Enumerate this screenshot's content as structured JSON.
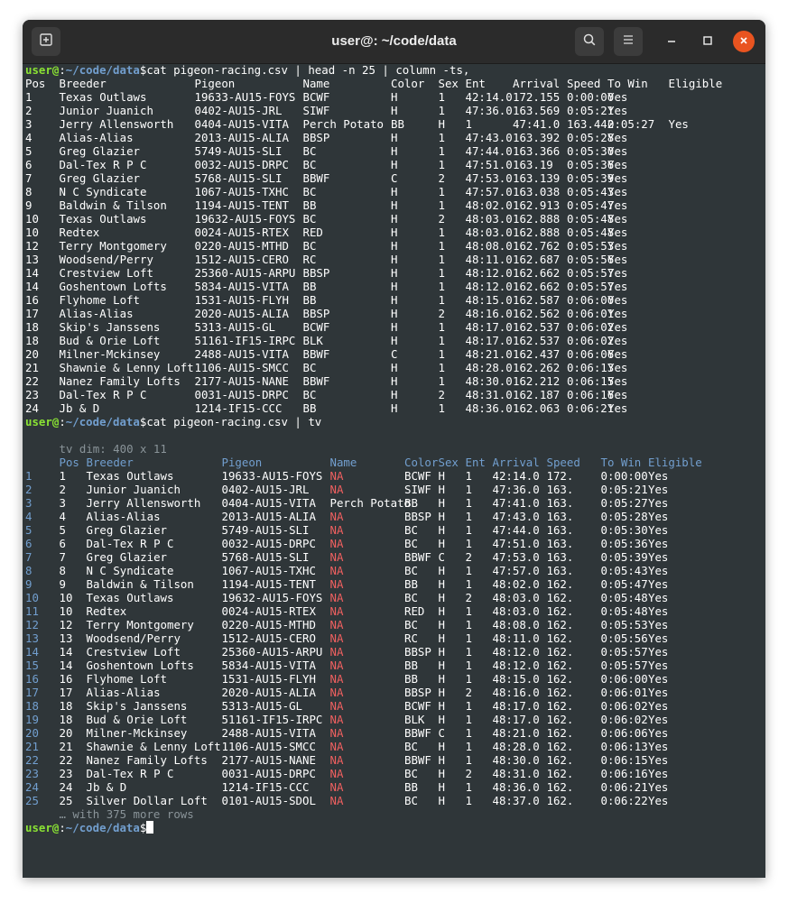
{
  "window": {
    "title": "user@: ~/code/data"
  },
  "titlebar_icons": {
    "new_tab": "new-tab-icon",
    "search": "search-icon",
    "menu": "hamburger-menu-icon",
    "minimize": "minimize-icon",
    "maximize": "maximize-icon",
    "close": "close-icon"
  },
  "prompt": {
    "user": "user@",
    "sep": ":",
    "path": "~/code/data",
    "dollar": "$"
  },
  "commands": [
    "cat pigeon-racing.csv | head -n 25 | column -ts,",
    "cat pigeon-racing.csv | tv"
  ],
  "csv_header": [
    "Pos",
    "Breeder",
    "Pigeon",
    "Name",
    "Color",
    "Sex",
    "Ent",
    "Arrival",
    "Speed",
    "To Win",
    "Eligible"
  ],
  "csv_rows": [
    [
      "1",
      "Texas Outlaws",
      "19633-AU15-FOYS",
      "BCWF",
      "H",
      "1",
      "42:14.0",
      "172.155",
      "0:00:00",
      "Yes"
    ],
    [
      "2",
      "Junior Juanich",
      "0402-AU15-JRL",
      "SIWF",
      "H",
      "1",
      "47:36.0",
      "163.569",
      "0:05:21",
      "Yes"
    ],
    [
      "3",
      "Jerry Allensworth",
      "0404-AU15-VITA",
      "Perch Potato",
      "BB",
      "H",
      "1",
      "47:41.0",
      "163.442",
      "0:05:27",
      "Yes"
    ],
    [
      "4",
      "Alias-Alias",
      "2013-AU15-ALIA",
      "BBSP",
      "H",
      "1",
      "47:43.0",
      "163.392",
      "0:05:28",
      "Yes"
    ],
    [
      "5",
      "Greg Glazier",
      "5749-AU15-SLI",
      "BC",
      "H",
      "1",
      "47:44.0",
      "163.366",
      "0:05:30",
      "Yes"
    ],
    [
      "6",
      "Dal-Tex R P C",
      "0032-AU15-DRPC",
      "BC",
      "H",
      "1",
      "47:51.0",
      "163.19",
      "0:05:36",
      "Yes"
    ],
    [
      "7",
      "Greg Glazier",
      "5768-AU15-SLI",
      "BBWF",
      "C",
      "2",
      "47:53.0",
      "163.139",
      "0:05:39",
      "Yes"
    ],
    [
      "8",
      "N C Syndicate",
      "1067-AU15-TXHC",
      "BC",
      "H",
      "1",
      "47:57.0",
      "163.038",
      "0:05:43",
      "Yes"
    ],
    [
      "9",
      "Baldwin & Tilson",
      "1194-AU15-TENT",
      "BB",
      "H",
      "1",
      "48:02.0",
      "162.913",
      "0:05:47",
      "Yes"
    ],
    [
      "10",
      "Texas Outlaws",
      "19632-AU15-FOYS",
      "BC",
      "H",
      "2",
      "48:03.0",
      "162.888",
      "0:05:48",
      "Yes"
    ],
    [
      "10",
      "Redtex",
      "0024-AU15-RTEX",
      "RED",
      "H",
      "1",
      "48:03.0",
      "162.888",
      "0:05:48",
      "Yes"
    ],
    [
      "12",
      "Terry Montgomery",
      "0220-AU15-MTHD",
      "BC",
      "H",
      "1",
      "48:08.0",
      "162.762",
      "0:05:53",
      "Yes"
    ],
    [
      "13",
      "Woodsend/Perry",
      "1512-AU15-CERO",
      "RC",
      "H",
      "1",
      "48:11.0",
      "162.687",
      "0:05:56",
      "Yes"
    ],
    [
      "14",
      "Crestview Loft",
      "25360-AU15-ARPU",
      "BBSP",
      "H",
      "1",
      "48:12.0",
      "162.662",
      "0:05:57",
      "Yes"
    ],
    [
      "14",
      "Goshentown Lofts",
      "5834-AU15-VITA",
      "BB",
      "H",
      "1",
      "48:12.0",
      "162.662",
      "0:05:57",
      "Yes"
    ],
    [
      "16",
      "Flyhome Loft",
      "1531-AU15-FLYH",
      "BB",
      "H",
      "1",
      "48:15.0",
      "162.587",
      "0:06:00",
      "Yes"
    ],
    [
      "17",
      "Alias-Alias",
      "2020-AU15-ALIA",
      "BBSP",
      "H",
      "2",
      "48:16.0",
      "162.562",
      "0:06:01",
      "Yes"
    ],
    [
      "18",
      "Skip's Janssens",
      "5313-AU15-GL",
      "BCWF",
      "H",
      "1",
      "48:17.0",
      "162.537",
      "0:06:02",
      "Yes"
    ],
    [
      "18",
      "Bud & Orie Loft",
      "51161-IF15-IRPC",
      "BLK",
      "H",
      "1",
      "48:17.0",
      "162.537",
      "0:06:02",
      "Yes"
    ],
    [
      "20",
      "Milner-Mckinsey",
      "2488-AU15-VITA",
      "BBWF",
      "C",
      "1",
      "48:21.0",
      "162.437",
      "0:06:06",
      "Yes"
    ],
    [
      "21",
      "Shawnie & Lenny Loft",
      "1106-AU15-SMCC",
      "BC",
      "H",
      "1",
      "48:28.0",
      "162.262",
      "0:06:13",
      "Yes"
    ],
    [
      "22",
      "Nanez Family Lofts",
      "2177-AU15-NANE",
      "BBWF",
      "H",
      "1",
      "48:30.0",
      "162.212",
      "0:06:15",
      "Yes"
    ],
    [
      "23",
      "Dal-Tex R P C",
      "0031-AU15-DRPC",
      "BC",
      "H",
      "2",
      "48:31.0",
      "162.187",
      "0:06:16",
      "Yes"
    ],
    [
      "24",
      "Jb & D",
      "1214-IF15-CCC",
      "BB",
      "H",
      "1",
      "48:36.0",
      "162.063",
      "0:06:21",
      "Yes"
    ]
  ],
  "tv": {
    "dim_line": "tv dim: 400 x 11",
    "header": [
      "Pos",
      "Breeder",
      "Pigeon",
      "Name",
      "Color",
      "Sex",
      "Ent",
      "Arrival",
      "Speed",
      "To Win",
      "Eligible"
    ],
    "rows": [
      [
        "1",
        "1",
        "Texas Outlaws",
        "19633-AU15-FOYS",
        "NA",
        "BCWF",
        "H",
        "1",
        "42:14.0",
        "172.",
        "0:00:00",
        "Yes"
      ],
      [
        "2",
        "2",
        "Junior Juanich",
        "0402-AU15-JRL",
        "NA",
        "SIWF",
        "H",
        "1",
        "47:36.0",
        "163.",
        "0:05:21",
        "Yes"
      ],
      [
        "3",
        "3",
        "Jerry Allensworth",
        "0404-AU15-VITA",
        "Perch Potato",
        "BB",
        "H",
        "1",
        "47:41.0",
        "163.",
        "0:05:27",
        "Yes"
      ],
      [
        "4",
        "4",
        "Alias-Alias",
        "2013-AU15-ALIA",
        "NA",
        "BBSP",
        "H",
        "1",
        "47:43.0",
        "163.",
        "0:05:28",
        "Yes"
      ],
      [
        "5",
        "5",
        "Greg Glazier",
        "5749-AU15-SLI",
        "NA",
        "BC",
        "H",
        "1",
        "47:44.0",
        "163.",
        "0:05:30",
        "Yes"
      ],
      [
        "6",
        "6",
        "Dal-Tex R P C",
        "0032-AU15-DRPC",
        "NA",
        "BC",
        "H",
        "1",
        "47:51.0",
        "163.",
        "0:05:36",
        "Yes"
      ],
      [
        "7",
        "7",
        "Greg Glazier",
        "5768-AU15-SLI",
        "NA",
        "BBWF",
        "C",
        "2",
        "47:53.0",
        "163.",
        "0:05:39",
        "Yes"
      ],
      [
        "8",
        "8",
        "N C Syndicate",
        "1067-AU15-TXHC",
        "NA",
        "BC",
        "H",
        "1",
        "47:57.0",
        "163.",
        "0:05:43",
        "Yes"
      ],
      [
        "9",
        "9",
        "Baldwin & Tilson",
        "1194-AU15-TENT",
        "NA",
        "BB",
        "H",
        "1",
        "48:02.0",
        "162.",
        "0:05:47",
        "Yes"
      ],
      [
        "10",
        "10",
        "Texas Outlaws",
        "19632-AU15-FOYS",
        "NA",
        "BC",
        "H",
        "2",
        "48:03.0",
        "162.",
        "0:05:48",
        "Yes"
      ],
      [
        "11",
        "10",
        "Redtex",
        "0024-AU15-RTEX",
        "NA",
        "RED",
        "H",
        "1",
        "48:03.0",
        "162.",
        "0:05:48",
        "Yes"
      ],
      [
        "12",
        "12",
        "Terry Montgomery",
        "0220-AU15-MTHD",
        "NA",
        "BC",
        "H",
        "1",
        "48:08.0",
        "162.",
        "0:05:53",
        "Yes"
      ],
      [
        "13",
        "13",
        "Woodsend/Perry",
        "1512-AU15-CERO",
        "NA",
        "RC",
        "H",
        "1",
        "48:11.0",
        "162.",
        "0:05:56",
        "Yes"
      ],
      [
        "14",
        "14",
        "Crestview Loft",
        "25360-AU15-ARPU",
        "NA",
        "BBSP",
        "H",
        "1",
        "48:12.0",
        "162.",
        "0:05:57",
        "Yes"
      ],
      [
        "15",
        "14",
        "Goshentown Lofts",
        "5834-AU15-VITA",
        "NA",
        "BB",
        "H",
        "1",
        "48:12.0",
        "162.",
        "0:05:57",
        "Yes"
      ],
      [
        "16",
        "16",
        "Flyhome Loft",
        "1531-AU15-FLYH",
        "NA",
        "BB",
        "H",
        "1",
        "48:15.0",
        "162.",
        "0:06:00",
        "Yes"
      ],
      [
        "17",
        "17",
        "Alias-Alias",
        "2020-AU15-ALIA",
        "NA",
        "BBSP",
        "H",
        "2",
        "48:16.0",
        "162.",
        "0:06:01",
        "Yes"
      ],
      [
        "18",
        "18",
        "Skip's Janssens",
        "5313-AU15-GL",
        "NA",
        "BCWF",
        "H",
        "1",
        "48:17.0",
        "162.",
        "0:06:02",
        "Yes"
      ],
      [
        "19",
        "18",
        "Bud & Orie Loft",
        "51161-IF15-IRPC",
        "NA",
        "BLK",
        "H",
        "1",
        "48:17.0",
        "162.",
        "0:06:02",
        "Yes"
      ],
      [
        "20",
        "20",
        "Milner-Mckinsey",
        "2488-AU15-VITA",
        "NA",
        "BBWF",
        "C",
        "1",
        "48:21.0",
        "162.",
        "0:06:06",
        "Yes"
      ],
      [
        "21",
        "21",
        "Shawnie & Lenny Loft",
        "1106-AU15-SMCC",
        "NA",
        "BC",
        "H",
        "1",
        "48:28.0",
        "162.",
        "0:06:13",
        "Yes"
      ],
      [
        "22",
        "22",
        "Nanez Family Lofts",
        "2177-AU15-NANE",
        "NA",
        "BBWF",
        "H",
        "1",
        "48:30.0",
        "162.",
        "0:06:15",
        "Yes"
      ],
      [
        "23",
        "23",
        "Dal-Tex R P C",
        "0031-AU15-DRPC",
        "NA",
        "BC",
        "H",
        "2",
        "48:31.0",
        "162.",
        "0:06:16",
        "Yes"
      ],
      [
        "24",
        "24",
        "Jb & D",
        "1214-IF15-CCC",
        "NA",
        "BB",
        "H",
        "1",
        "48:36.0",
        "162.",
        "0:06:21",
        "Yes"
      ],
      [
        "25",
        "25",
        "Silver Dollar Loft",
        "0101-AU15-SDOL",
        "NA",
        "BC",
        "H",
        "1",
        "48:37.0",
        "162.",
        "0:06:22",
        "Yes"
      ]
    ],
    "footer": "… with 375 more rows"
  },
  "colors": {
    "terminal_bg": "#2f3639",
    "prompt_user": "#8ae234",
    "prompt_path": "#729fcf",
    "na": "#f06060",
    "close_button": "#e95420"
  }
}
